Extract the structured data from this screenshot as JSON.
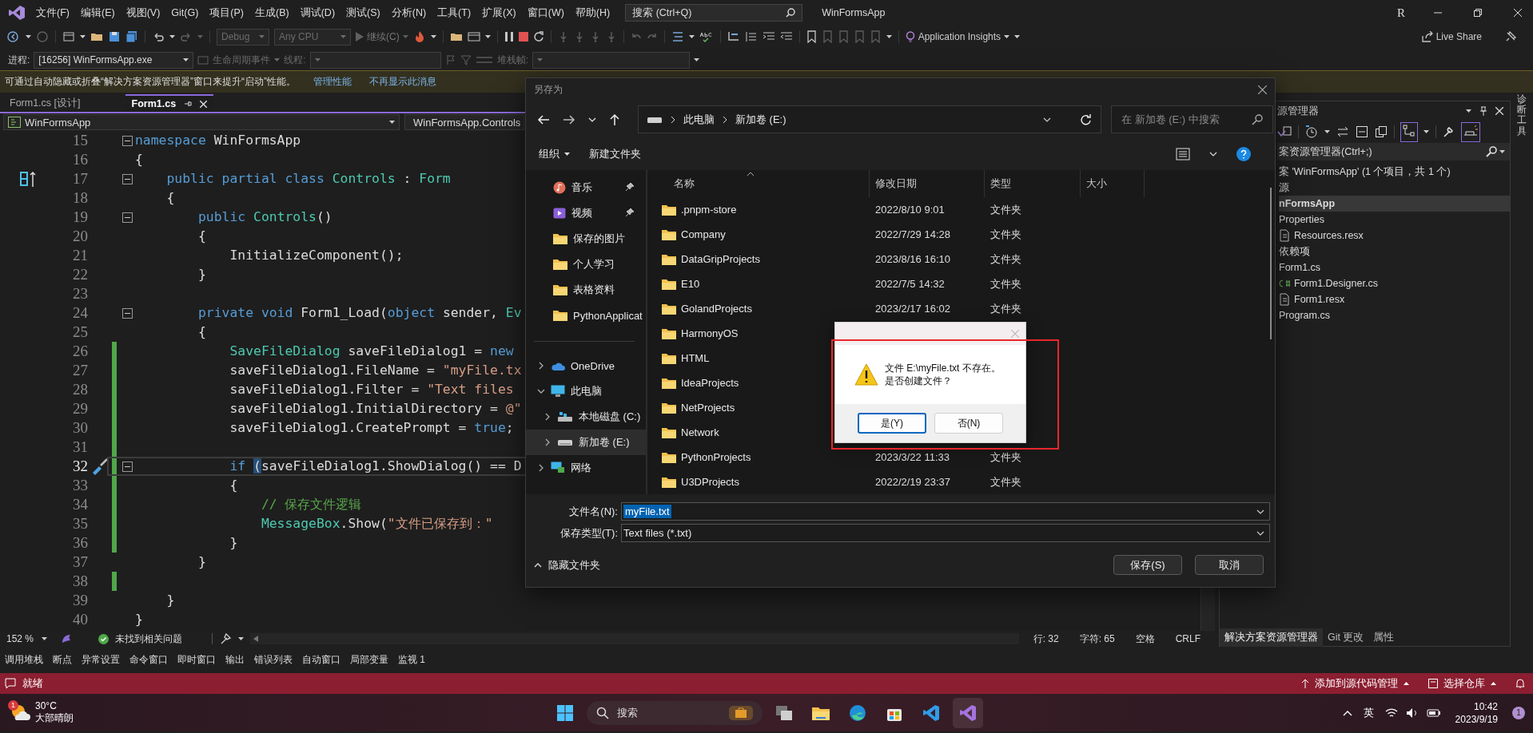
{
  "menu_bar": {
    "menus": [
      "文件(F)",
      "编辑(E)",
      "视图(V)",
      "Git(G)",
      "项目(P)",
      "生成(B)",
      "调试(D)",
      "测试(S)",
      "分析(N)",
      "工具(T)",
      "扩展(X)",
      "窗口(W)",
      "帮助(H)"
    ],
    "search": {
      "placeholder": "搜索 (Ctrl+Q)"
    },
    "title": "WinFormsApp",
    "account": "R"
  },
  "standard_toolbar": {
    "configuration": {
      "label": "Debug",
      "disabled": true
    },
    "platform": {
      "label": "Any CPU",
      "disabled": true
    },
    "continue": "继续(C)",
    "insights": "Application Insights",
    "live_share": "Live Share"
  },
  "debug_location": {
    "process_label": "进程:",
    "process": "[16256] WinFormsApp.exe",
    "lifecycle": "生命周期事件",
    "thread_label": "线程:",
    "stack_label": "堆栈帧:"
  },
  "info_bar": {
    "message": "可通过自动隐藏或折叠“解决方案资源管理器”窗口来提升“启动”性能。",
    "links": [
      "管理性能",
      "不再显示此消息"
    ]
  },
  "editor": {
    "tabs": [
      {
        "label": "Form1.cs [设计]",
        "selected": false
      },
      {
        "label": "Form1.cs",
        "selected": true
      }
    ],
    "project_scope": "WinFormsApp",
    "type_scope": "WinFormsApp.Controls",
    "lines": [
      {
        "number": "15",
        "fold": true,
        "changed": false,
        "current": false,
        "tokens": [
          {
            "kind": "keyword",
            "text": "namespace"
          },
          {
            "kind": "plain",
            "text": " WinFormsApp"
          }
        ]
      },
      {
        "number": "16",
        "fold": false,
        "changed": false,
        "current": false,
        "tokens": [
          {
            "kind": "plain",
            "text": "{"
          }
        ]
      },
      {
        "number": "17",
        "fold": true,
        "changed": false,
        "current": false,
        "gutter": {
          "kind": "class-marker"
        },
        "tokens": [
          {
            "kind": "keyword",
            "text": "    public partial class "
          },
          {
            "kind": "type",
            "text": "Controls"
          },
          {
            "kind": "plain",
            "text": " : "
          },
          {
            "kind": "type",
            "text": "Form"
          }
        ]
      },
      {
        "number": "18",
        "fold": false,
        "changed": false,
        "current": false,
        "tokens": [
          {
            "kind": "plain",
            "text": "    {"
          }
        ]
      },
      {
        "number": "19",
        "fold": true,
        "changed": false,
        "current": false,
        "tokens": [
          {
            "kind": "keyword",
            "text": "        public "
          },
          {
            "kind": "type",
            "text": "Controls"
          },
          {
            "kind": "plain",
            "text": "()"
          }
        ]
      },
      {
        "number": "20",
        "fold": false,
        "changed": false,
        "current": false,
        "tokens": [
          {
            "kind": "plain",
            "text": "        {"
          }
        ]
      },
      {
        "number": "21",
        "fold": false,
        "changed": false,
        "current": false,
        "tokens": [
          {
            "kind": "plain",
            "text": "            InitializeComponent();"
          }
        ]
      },
      {
        "number": "22",
        "fold": false,
        "changed": false,
        "current": false,
        "tokens": [
          {
            "kind": "plain",
            "text": "        }"
          }
        ]
      },
      {
        "number": "23",
        "fold": false,
        "changed": false,
        "current": false
      },
      {
        "number": "24",
        "fold": true,
        "changed": false,
        "current": false,
        "tokens": [
          {
            "kind": "keyword",
            "text": "        private void "
          },
          {
            "kind": "plain",
            "text": "Form1_Load("
          },
          {
            "kind": "keyword",
            "text": "object"
          },
          {
            "kind": "plain",
            "text": " sender, "
          },
          {
            "kind": "type",
            "text": "Ev"
          }
        ]
      },
      {
        "number": "25",
        "fold": false,
        "changed": false,
        "current": false,
        "tokens": [
          {
            "kind": "plain",
            "text": "        {"
          }
        ]
      },
      {
        "number": "26",
        "fold": false,
        "changed": true,
        "current": false,
        "tokens": [
          {
            "kind": "type",
            "text": "            SaveFileDialog"
          },
          {
            "kind": "plain",
            "text": " saveFileDialog1 = "
          },
          {
            "kind": "keyword",
            "text": "new"
          }
        ]
      },
      {
        "number": "27",
        "fold": false,
        "changed": true,
        "current": false,
        "tokens": [
          {
            "kind": "plain",
            "text": "            saveFileDialog1.FileName = "
          },
          {
            "kind": "string",
            "text": "\"myFile.tx"
          }
        ]
      },
      {
        "number": "28",
        "fold": false,
        "changed": true,
        "current": false,
        "tokens": [
          {
            "kind": "plain",
            "text": "            saveFileDialog1.Filter = "
          },
          {
            "kind": "string",
            "text": "\"Text files"
          }
        ]
      },
      {
        "number": "29",
        "fold": false,
        "changed": true,
        "current": false,
        "tokens": [
          {
            "kind": "plain",
            "text": "            saveFileDialog1.InitialDirectory = "
          },
          {
            "kind": "string",
            "text": "@\""
          }
        ]
      },
      {
        "number": "30",
        "fold": false,
        "changed": true,
        "current": false,
        "tokens": [
          {
            "kind": "plain",
            "text": "            saveFileDialog1.CreatePrompt = "
          },
          {
            "kind": "keyword",
            "text": "true"
          },
          {
            "kind": "plain",
            "text": ";"
          }
        ]
      },
      {
        "number": "31",
        "fold": false,
        "changed": true,
        "current": false
      },
      {
        "number": "32",
        "fold": true,
        "changed": true,
        "current": true,
        "gutter": {
          "kind": "quick-actions"
        },
        "tokens": [
          {
            "kind": "keyword",
            "text": "            if "
          },
          {
            "kind": "match",
            "text": "("
          },
          {
            "kind": "plain",
            "text": "saveFileDialog1.ShowDialog() == D"
          }
        ]
      },
      {
        "number": "33",
        "fold": false,
        "changed": true,
        "current": false,
        "tokens": [
          {
            "kind": "plain",
            "text": "            {"
          }
        ]
      },
      {
        "number": "34",
        "fold": false,
        "changed": true,
        "current": false,
        "tokens": [
          {
            "kind": "comment",
            "text": "                // 保存文件逻辑"
          }
        ]
      },
      {
        "number": "35",
        "fold": false,
        "changed": true,
        "current": false,
        "tokens": [
          {
            "kind": "type",
            "text": "                MessageBox"
          },
          {
            "kind": "plain",
            "text": ".Show("
          },
          {
            "kind": "string",
            "text": "\"文件已保存到：\""
          }
        ]
      },
      {
        "number": "36",
        "fold": false,
        "changed": true,
        "current": false,
        "tokens": [
          {
            "kind": "plain",
            "text": "            }"
          }
        ]
      },
      {
        "number": "37",
        "fold": false,
        "changed": false,
        "current": false,
        "tokens": [
          {
            "kind": "plain",
            "text": "        }"
          }
        ]
      },
      {
        "number": "38",
        "fold": false,
        "changed": true,
        "current": false
      },
      {
        "number": "39",
        "fold": false,
        "changed": false,
        "current": false,
        "tokens": [
          {
            "kind": "plain",
            "text": "    }"
          }
        ]
      },
      {
        "number": "40",
        "fold": false,
        "changed": false,
        "current": false,
        "tokens": [
          {
            "kind": "plain",
            "text": "}"
          }
        ]
      }
    ],
    "zoom": "152 %",
    "issues": "未找到相关问题",
    "position": [
      "行: 32",
      "字符: 65",
      "空格",
      "CRLF"
    ]
  },
  "solution_explorer": {
    "title": "源管理器",
    "search": {
      "placeholder": "案资源管理器(Ctrl+;)"
    },
    "items": [
      {
        "label": "案 'WinFormsApp' (1 个项目，共 1 个)",
        "kind": "plain",
        "selected": false
      },
      {
        "label": "源",
        "kind": "plain",
        "selected": false
      },
      {
        "label": "nFormsApp",
        "kind": "project",
        "selected": true
      },
      {
        "label": "Properties",
        "kind": "plain",
        "selected": false
      },
      {
        "label": "Resources.resx",
        "kind": "resx",
        "selected": false
      },
      {
        "label": "依赖项",
        "kind": "plain",
        "selected": false
      },
      {
        "label": "Form1.cs",
        "kind": "plain",
        "selected": false
      },
      {
        "label": "Form1.Designer.cs",
        "kind": "csharp",
        "selected": false
      },
      {
        "label": "Form1.resx",
        "kind": "resx",
        "selected": false
      },
      {
        "label": "Program.cs",
        "kind": "plain",
        "selected": false
      }
    ],
    "tabs": [
      {
        "label": "解决方案资源管理器",
        "selected": true
      },
      {
        "label": "Git 更改",
        "selected": false
      },
      {
        "label": "属性",
        "selected": false
      }
    ]
  },
  "diagnostics_tab": "诊断工具",
  "tool_windows": [
    "调用堆栈",
    "断点",
    "异常设置",
    "命令窗口",
    "即时窗口",
    "输出",
    "错误列表",
    "自动窗口",
    "局部变量",
    "监视 1"
  ],
  "status_bar": {
    "text": "就绪",
    "source_control": "添加到源代码管理",
    "repository": "选择仓库"
  },
  "save_dialog": {
    "title": "另存为",
    "path": [
      "此电脑",
      "新加卷 (E:)"
    ],
    "search": {
      "placeholder": "在 新加卷 (E:) 中搜索"
    },
    "commands": [
      "组织",
      "新建文件夹"
    ],
    "quick_access": [
      {
        "label": "音乐",
        "kind": "music",
        "pinned": true,
        "selected": false
      },
      {
        "label": "视频",
        "kind": "video",
        "pinned": true,
        "selected": false
      },
      {
        "label": "保存的图片",
        "kind": "folder",
        "pinned": false,
        "selected": false
      },
      {
        "label": "个人学习",
        "kind": "folder",
        "pinned": false,
        "selected": false
      },
      {
        "label": "表格资料",
        "kind": "folder",
        "pinned": false,
        "selected": false
      },
      {
        "label": "PythonApplicat",
        "kind": "folder",
        "pinned": false,
        "selected": false
      }
    ],
    "locations": [
      {
        "label": "OneDrive",
        "kind": "cloud",
        "expanded": false,
        "selected": false
      },
      {
        "label": "此电脑",
        "kind": "pc",
        "expanded": true,
        "selected": false,
        "children": [
          {
            "label": "本地磁盘 (C:)",
            "kind": "disk",
            "expanded": false,
            "selected": false
          },
          {
            "label": "新加卷 (E:)",
            "kind": "drive",
            "expanded": false,
            "selected": true
          }
        ]
      },
      {
        "label": "网络",
        "kind": "network",
        "expanded": false,
        "selected": false
      }
    ],
    "columns": [
      "名称",
      "修改日期",
      "类型",
      "大小"
    ],
    "files": [
      {
        "name": ".pnpm-store",
        "modified": "2022/8/10 9:01",
        "type": "文件夹"
      },
      {
        "name": "Company",
        "modified": "2022/7/29 14:28",
        "type": "文件夹"
      },
      {
        "name": "DataGripProjects",
        "modified": "2023/8/16 16:10",
        "type": "文件夹"
      },
      {
        "name": "E10",
        "modified": "2022/7/5 14:32",
        "type": "文件夹"
      },
      {
        "name": "GolandProjects",
        "modified": "2023/2/17 16:02",
        "type": "文件夹"
      },
      {
        "name": "HarmonyOS"
      },
      {
        "name": "HTML"
      },
      {
        "name": "IdeaProjects"
      },
      {
        "name": "NetProjects"
      },
      {
        "name": "Network"
      },
      {
        "name": "PythonProjects",
        "modified": "2023/3/22 11:33",
        "type": "文件夹"
      },
      {
        "name": "U3DProjects",
        "modified": "2022/2/19 23:37",
        "type": "文件夹"
      }
    ],
    "file_name": {
      "label": "文件名(N):",
      "value": "myFile.txt"
    },
    "file_type": {
      "label": "保存类型(T):",
      "value": "Text files (*.txt)"
    },
    "hide_folders": "隐藏文件夹",
    "buttons": [
      "保存(S)",
      "取消"
    ],
    "alert": {
      "message": [
        "文件 E:\\myFile.txt 不存在。",
        "是否创建文件？"
      ],
      "buttons": [
        {
          "label": "是(Y)",
          "default": true
        },
        {
          "label": "否(N)",
          "default": false
        }
      ]
    }
  },
  "taskbar": {
    "weather": {
      "temperature": "30°C",
      "condition": "大部晴朗",
      "badge": "1"
    },
    "search": {
      "placeholder": "搜索"
    },
    "apps": [
      {
        "kind": "taskview",
        "active": false
      },
      {
        "kind": "explorer",
        "active": false
      },
      {
        "kind": "edge",
        "active": false
      },
      {
        "kind": "store",
        "active": false
      },
      {
        "kind": "vscode",
        "active": false
      },
      {
        "kind": "visualstudio",
        "active": true
      }
    ],
    "input_method": "英",
    "time": "10:42",
    "date": "2023/9/19",
    "notifications": "1"
  }
}
